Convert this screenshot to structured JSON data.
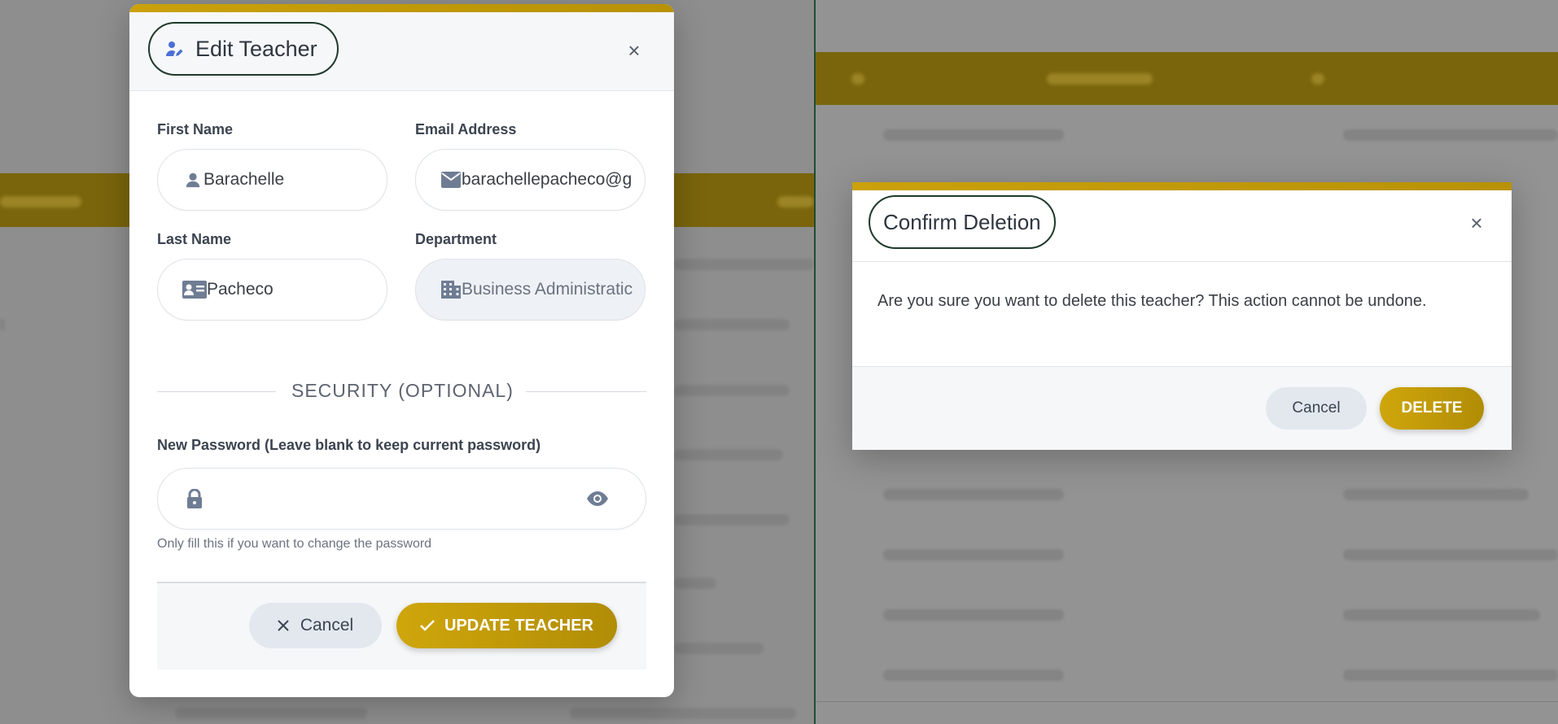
{
  "edit_modal": {
    "title": "Edit Teacher",
    "close": "×",
    "first_name": {
      "label": "First Name",
      "value": "Barachelle"
    },
    "email": {
      "label": "Email Address",
      "value": "barachellepacheco@g"
    },
    "last_name": {
      "label": "Last Name",
      "value": "Pacheco"
    },
    "department": {
      "label": "Department",
      "value": "Business Administratic"
    },
    "security_title": "SECURITY (OPTIONAL)",
    "password": {
      "label": "New Password (Leave blank to keep current password)",
      "value": "",
      "help": "Only fill this if you want to change the password"
    },
    "cancel_label": "Cancel",
    "update_label": "UPDATE TEACHER"
  },
  "delete_modal": {
    "title": "Confirm Deletion",
    "close": "×",
    "message": "Are you sure you want to delete this teacher? This action cannot be undone.",
    "cancel_label": "Cancel",
    "delete_label": "DELETE"
  },
  "colors": {
    "accent": "#caa10b",
    "accent_dark": "#b18d06",
    "overlay": "#8e8e8e",
    "divider": "#1f4d33",
    "pill_border": "#1e3a2a"
  },
  "icons": [
    "edit-user-icon",
    "close-icon",
    "user-icon",
    "mail-icon",
    "id-card-icon",
    "building-icon",
    "lock-icon",
    "eye-icon",
    "x-icon",
    "check-icon"
  ]
}
